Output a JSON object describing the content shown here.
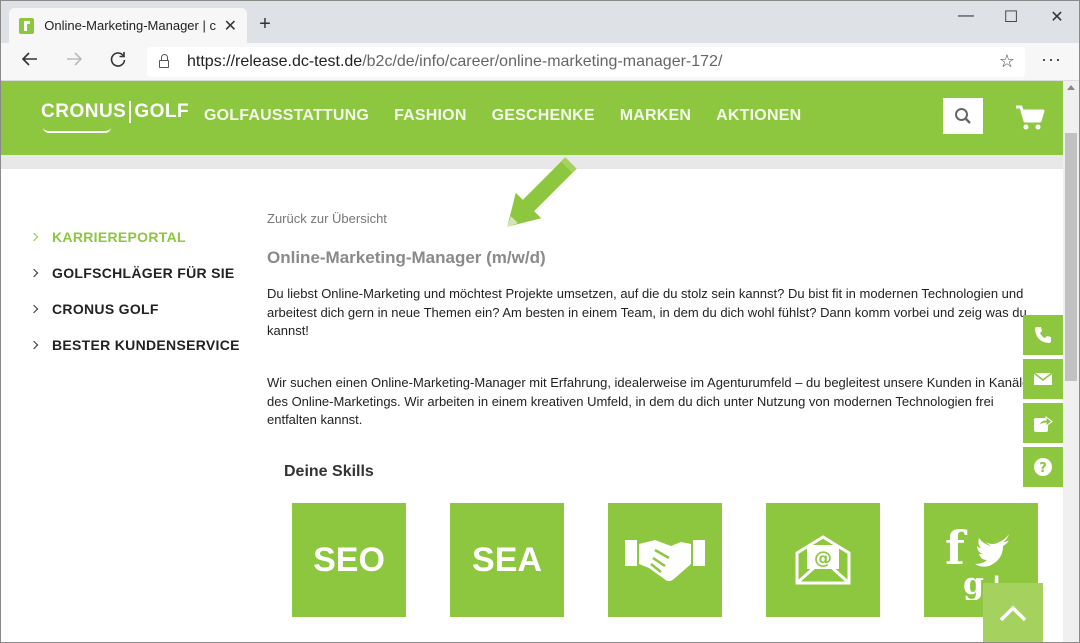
{
  "browser": {
    "tab_title": "Online-Marketing-Manager | cro",
    "new_tab": "+",
    "minimize": "—",
    "maximize": "☐",
    "close": "✕",
    "url_host": "https://release.dc-test.de",
    "url_path": "/b2c/de/info/career/online-marketing-manager-172/",
    "more": "···"
  },
  "site": {
    "logo_left": "CRONUS",
    "logo_right": "GOLF",
    "nav": [
      "GOLFAUSSTATTUNG",
      "FASHION",
      "GESCHENKE",
      "MARKEN",
      "AKTIONEN"
    ]
  },
  "sidebar": {
    "items": [
      {
        "label": "KARRIEREPORTAL",
        "active": true
      },
      {
        "label": "GOLFSCHLÄGER FÜR SIE",
        "active": false
      },
      {
        "label": "CRONUS GOLF",
        "active": false
      },
      {
        "label": "BESTER KUNDENSERVICE",
        "active": false
      }
    ]
  },
  "content": {
    "back_link": "Zurück zur Übersicht",
    "title": "Online-Marketing-Manager (m/w/d)",
    "paragraph1": "Du liebst Online-Marketing und möchtest Projekte umsetzen, auf die du stolz sein kannst? Du bist fit in modernen Technologien und arbeitest dich gern in neue Themen ein? Am besten in einem Team, in dem du dich wohl fühlst? Dann komm vorbei und zeig was du kannst!",
    "paragraph2": "Wir suchen einen Online-Marketing-Manager mit Erfahrung, idealerweise im Agenturumfeld – du begleitest unsere Kunden in Kanälen des Online-Marketings. Wir arbeiten in einem kreativen Umfeld, in dem du dich unter Nutzung von modernen Technologien frei entfalten kannst.",
    "skills_heading": "Deine Skills",
    "skills": [
      "SEO",
      "SEA"
    ]
  },
  "colors": {
    "brand_green": "#8dc63f"
  }
}
